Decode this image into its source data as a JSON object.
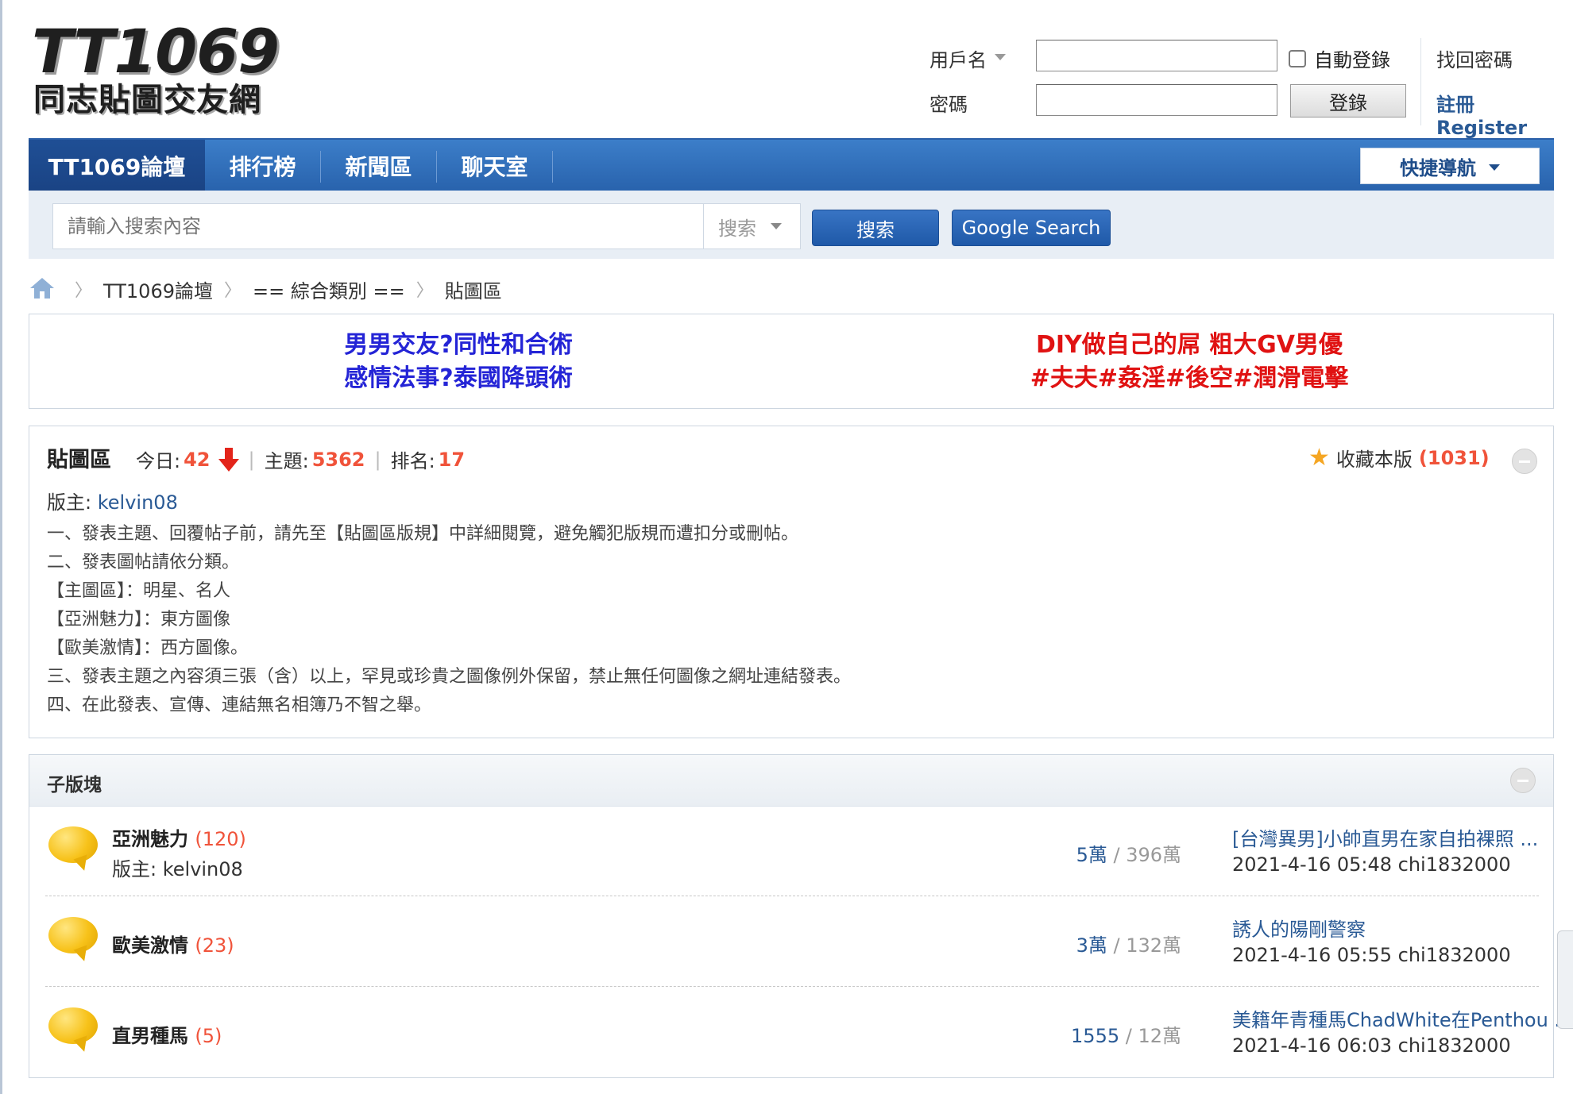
{
  "logo": {
    "main": "TT1069",
    "sub": "同志貼圖交友網"
  },
  "login": {
    "username_label": "用戶名",
    "password_label": "密碼",
    "username_value": "",
    "password_value": "",
    "auto_login_label": "自動登錄",
    "login_button": "登錄",
    "recover_link": "找回密碼",
    "register_link": "註冊Register"
  },
  "nav": {
    "items": [
      {
        "label": "TT1069論壇",
        "active": true
      },
      {
        "label": "排行榜",
        "active": false
      },
      {
        "label": "新聞區",
        "active": false
      },
      {
        "label": "聊天室",
        "active": false
      }
    ],
    "quick_nav": "快捷導航"
  },
  "search": {
    "placeholder": "請輸入搜索內容",
    "type_selected": "搜索",
    "search_button": "搜索",
    "google_button": "Google Search"
  },
  "breadcrumb": [
    "TT1069論壇",
    "== 綜合類別 ==",
    "貼圖區"
  ],
  "ads": {
    "left": [
      "男男交友?同性和合術",
      "感情法事?泰國降頭術"
    ],
    "right": [
      "DIY做自己的屌 粗大GV男優",
      "#夫夫#姦淫#後空#潤滑電擊"
    ]
  },
  "forum": {
    "title": "貼圖區",
    "today_label": "今日:",
    "today": "42",
    "topics_label": "主題:",
    "topics": "5362",
    "rank_label": "排名:",
    "rank": "17",
    "favorite_label": "收藏本版",
    "favorite_count": "(1031)",
    "moderator_label": "版主:",
    "moderator": "kelvin08",
    "rules": [
      "一、發表主題、回覆帖子前，請先至【貼圖區版規】中詳細閱覽，避免觸犯版規而遭扣分或刪帖。",
      "二、發表圖帖請依分類。",
      "【主圖區】：明星、名人",
      "【亞洲魅力】：東方圖像",
      "【歐美激情】：西方圖像。",
      "三、發表主題之內容須三張（含）以上，罕見或珍貴之圖像例外保留，禁止無任何圖像之網址連結發表。",
      "四、在此發表、宣傳、連結無名相簿乃不智之舉。"
    ]
  },
  "subforums": {
    "title": "子版塊",
    "items": [
      {
        "name": "亞洲魅力",
        "count": "(120)",
        "moderator": "版主: kelvin08",
        "threads": "5萬",
        "posts": "396萬",
        "last_title": "[台灣異男]小帥直男在家自拍裸照 ...",
        "last_meta": "2021-4-16 05:48 chi1832000"
      },
      {
        "name": "歐美激情",
        "count": "(23)",
        "moderator": "",
        "threads": "3萬",
        "posts": "132萬",
        "last_title": "誘人的陽剛警察",
        "last_meta": "2021-4-16 05:55 chi1832000"
      },
      {
        "name": "直男種馬",
        "count": "(5)",
        "moderator": "",
        "threads": "1555",
        "posts": "12萬",
        "last_title": "美籍年青種馬ChadWhite在Penthou ...",
        "last_meta": "2021-4-16 06:03 chi1832000"
      }
    ]
  }
}
